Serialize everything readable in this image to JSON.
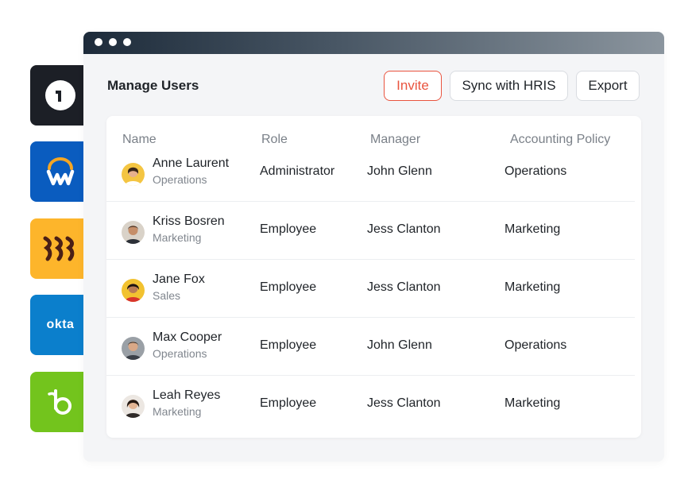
{
  "header": {
    "title": "Manage Users",
    "buttons": {
      "invite": "Invite",
      "sync": "Sync with HRIS",
      "export": "Export"
    }
  },
  "table": {
    "columns": [
      "Name",
      "Role",
      "Manager",
      "Accounting Policy"
    ],
    "rows": [
      {
        "name": "Anne Laurent",
        "department": "Operations",
        "role": "Administrator",
        "manager": "John Glenn",
        "policy": "Operations"
      },
      {
        "name": "Kriss Bosren",
        "department": "Marketing",
        "role": "Employee",
        "manager": "Jess Clanton",
        "policy": "Marketing"
      },
      {
        "name": "Jane Fox",
        "department": "Sales",
        "role": "Employee",
        "manager": "Jess Clanton",
        "policy": "Marketing"
      },
      {
        "name": "Max Cooper",
        "department": "Operations",
        "role": "Employee",
        "manager": "John Glenn",
        "policy": "Operations"
      },
      {
        "name": "Leah Reyes",
        "department": "Marketing",
        "role": "Employee",
        "manager": "Jess Clanton",
        "policy": "Marketing"
      }
    ]
  },
  "integrations": {
    "okta_wordmark": "okta",
    "icons": [
      "onelogin-icon",
      "workday-icon",
      "rippling-icon",
      "okta-icon",
      "bamboohr-icon"
    ],
    "colors": {
      "onelogin": "#1c1f26",
      "workday": "#0a5cbf",
      "rippling": "#fdb52b",
      "okta": "#0b7fcc",
      "bamboohr": "#73c41d"
    }
  },
  "colors": {
    "accent": "#e9543f"
  }
}
